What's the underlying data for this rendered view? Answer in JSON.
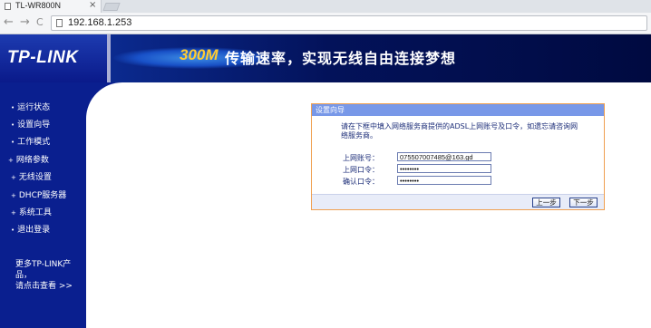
{
  "browser": {
    "tab_title": "TL-WR800N",
    "tab_close": "×",
    "back": "←",
    "forward": "→",
    "reload": "C",
    "url": "192.168.1.253"
  },
  "banner": {
    "logo": "TP-LINK",
    "slogan_highlight": "300M",
    "slogan": "传输速率，实现无线自由连接梦想"
  },
  "sidebar": {
    "items": [
      {
        "label": "运行状态",
        "bullet": "•"
      },
      {
        "label": "设置向导",
        "bullet": "•"
      },
      {
        "label": "工作模式",
        "bullet": "•"
      },
      {
        "label": "网络参数",
        "bullet": "+"
      },
      {
        "label": "无线设置",
        "bullet": "+"
      },
      {
        "label": "DHCP服务器",
        "bullet": "+"
      },
      {
        "label": "系统工具",
        "bullet": "+"
      },
      {
        "label": "退出登录",
        "bullet": "•"
      }
    ],
    "more_line1": "更多TP-LINK产品，",
    "more_line2": "请点击查看 >>"
  },
  "wizard": {
    "title": "设置向导",
    "description": "请在下框中填入网络服务商提供的ADSL上网账号及口令，如遗忘请咨询网络服务商。",
    "account_label": "上网账号：",
    "account_value": "075507007485@163.gd",
    "password_label": "上网口令：",
    "password_value": "••••••••",
    "confirm_label": "确认口令：",
    "confirm_value": "••••••••",
    "prev_button": "上一步",
    "next_button": "下一步"
  },
  "colors": {
    "sidebar_bg": "#0a1f8f",
    "panel_header": "#7898e8",
    "panel_border": "#f0a050",
    "slogan_accent": "#ffcc33"
  }
}
